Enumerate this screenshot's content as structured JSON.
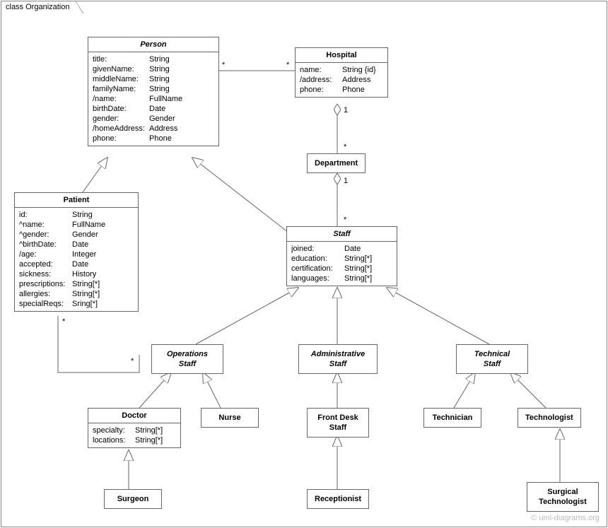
{
  "frame": {
    "title": "class Organization"
  },
  "watermark": "© uml-diagrams.org",
  "classes": {
    "person": {
      "name": "Person",
      "attrs": [
        {
          "n": "title:",
          "t": "String"
        },
        {
          "n": "givenName:",
          "t": "String"
        },
        {
          "n": "middleName:",
          "t": "String"
        },
        {
          "n": "familyName:",
          "t": "String"
        },
        {
          "n": "/name:",
          "t": "FullName"
        },
        {
          "n": "birthDate:",
          "t": "Date"
        },
        {
          "n": "gender:",
          "t": "Gender"
        },
        {
          "n": "/homeAddress:",
          "t": "Address"
        },
        {
          "n": "phone:",
          "t": "Phone"
        }
      ]
    },
    "hospital": {
      "name": "Hospital",
      "attrs": [
        {
          "n": "name:",
          "t": "String {id}"
        },
        {
          "n": "/address:",
          "t": "Address"
        },
        {
          "n": "phone:",
          "t": "Phone"
        }
      ]
    },
    "patient": {
      "name": "Patient",
      "attrs": [
        {
          "n": "id:",
          "t": "String"
        },
        {
          "n": "^name:",
          "t": "FullName"
        },
        {
          "n": "^gender:",
          "t": "Gender"
        },
        {
          "n": "^birthDate:",
          "t": "Date"
        },
        {
          "n": "/age:",
          "t": "Integer"
        },
        {
          "n": "accepted:",
          "t": "Date"
        },
        {
          "n": "sickness:",
          "t": "History"
        },
        {
          "n": "prescriptions:",
          "t": "String[*]"
        },
        {
          "n": "allergies:",
          "t": "String[*]"
        },
        {
          "n": "specialReqs:",
          "t": "Sring[*]"
        }
      ]
    },
    "department": {
      "name": "Department"
    },
    "staff": {
      "name": "Staff",
      "attrs": [
        {
          "n": "joined:",
          "t": "Date"
        },
        {
          "n": "education:",
          "t": "String[*]"
        },
        {
          "n": "certification:",
          "t": "String[*]"
        },
        {
          "n": "languages:",
          "t": "String[*]"
        }
      ]
    },
    "opsStaff": {
      "name": "Operations\nStaff"
    },
    "adminStaff": {
      "name": "Administrative\nStaff"
    },
    "techStaff": {
      "name": "Technical\nStaff"
    },
    "doctor": {
      "name": "Doctor",
      "attrs": [
        {
          "n": "specialty:",
          "t": "String[*]"
        },
        {
          "n": "locations:",
          "t": "String[*]"
        }
      ]
    },
    "nurse": {
      "name": "Nurse"
    },
    "frontDesk": {
      "name": "Front Desk\nStaff"
    },
    "technician": {
      "name": "Technician"
    },
    "technologist": {
      "name": "Technologist"
    },
    "surgeon": {
      "name": "Surgeon"
    },
    "receptionist": {
      "name": "Receptionist"
    },
    "surgTech": {
      "name": "Surgical\nTechnologist"
    }
  },
  "mults": {
    "assoc_person_hosp_left": "*",
    "assoc_person_hosp_right": "*",
    "hosp_dept_top": "1",
    "hosp_dept_bottom": "*",
    "dept_staff_top": "1",
    "dept_staff_bottom": "*",
    "patient_ops_top": "*",
    "patient_ops_bottom": "*"
  }
}
